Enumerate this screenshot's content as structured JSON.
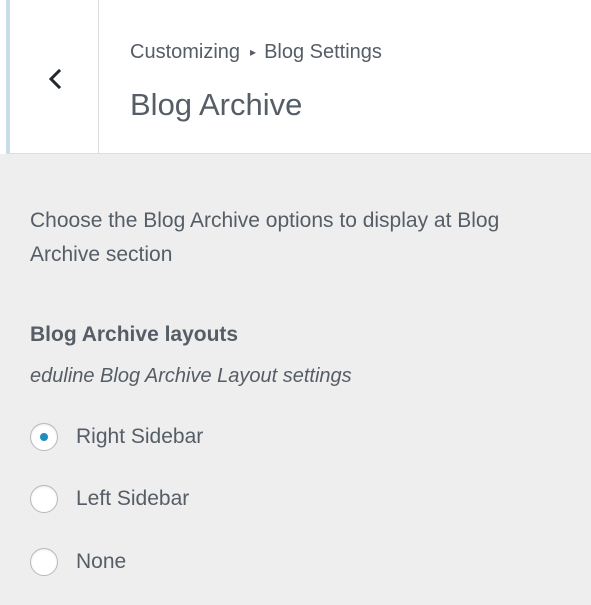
{
  "header": {
    "breadcrumb_root": "Customizing",
    "breadcrumb_separator": "▸",
    "breadcrumb_section": "Blog Settings",
    "title": "Blog Archive",
    "back_icon": "chevron-left-icon"
  },
  "section": {
    "description": "Choose the Blog Archive options to display at Blog Archive section"
  },
  "control": {
    "title": "Blog Archive layouts",
    "description": "eduline Blog Archive Layout settings",
    "options": [
      {
        "label": "Right Sidebar",
        "checked": true
      },
      {
        "label": "Left Sidebar",
        "checked": false
      },
      {
        "label": "None",
        "checked": false
      }
    ]
  },
  "colors": {
    "panel_background": "#eeeeee",
    "header_background": "#ffffff",
    "text": "#555d66",
    "accent": "#1e8cbe",
    "back_button_border": "#c9dde8"
  }
}
